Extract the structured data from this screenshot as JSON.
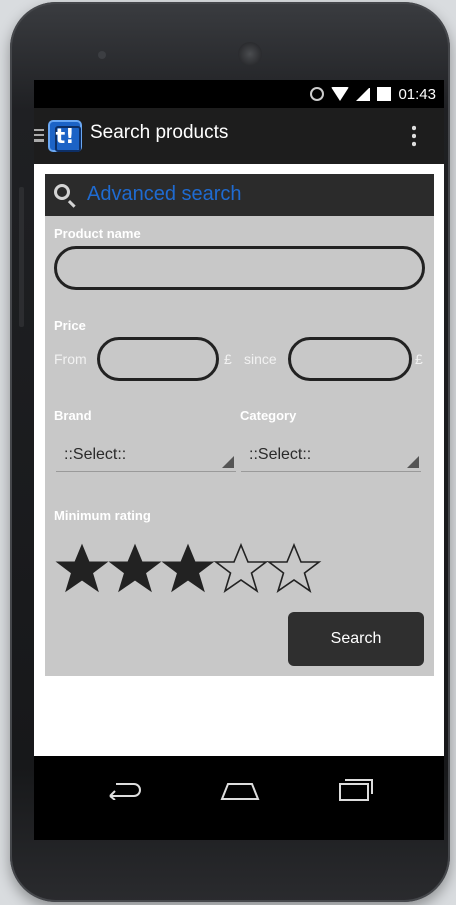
{
  "status_bar": {
    "time": "01:43"
  },
  "action_bar": {
    "logo_text": "t!",
    "title": "Search products"
  },
  "panel": {
    "title": "Advanced search",
    "product_name": {
      "label": "Product name",
      "value": ""
    },
    "price": {
      "label": "Price",
      "from_label": "From",
      "from_value": "",
      "from_unit": "£",
      "since_label": "since",
      "since_value": "",
      "since_unit": "£"
    },
    "brand": {
      "label": "Brand",
      "selected": "::Select::"
    },
    "category": {
      "label": "Category",
      "selected": "::Select::"
    },
    "rating": {
      "label": "Minimum rating",
      "value": 3,
      "max": 5
    },
    "search_button": "Search"
  },
  "colors": {
    "accent": "#1f6bd1",
    "panel_bg": "#c8c8c8",
    "header_bg": "#2b2b2b"
  },
  "icons": [
    "alarm-icon",
    "wifi-icon",
    "signal-icon",
    "battery-icon",
    "menu-icon",
    "logo-icon",
    "overflow-menu-icon",
    "search-icon",
    "star-icon",
    "back-icon",
    "home-icon",
    "recents-icon"
  ]
}
